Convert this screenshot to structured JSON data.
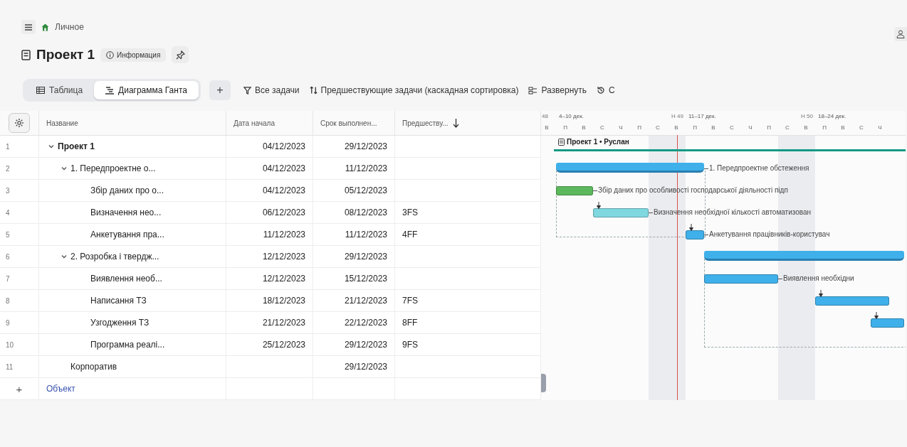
{
  "breadcrumb": {
    "label": "Личное"
  },
  "title": {
    "text": "Проект 1",
    "info_button": "Информация"
  },
  "view_tabs": [
    {
      "label": "Таблица",
      "selected": false
    },
    {
      "label": "Диаграмма Ганта",
      "selected": true
    }
  ],
  "add_view": "+",
  "toolbar": [
    {
      "kind": "filter",
      "label": "Все задачи"
    },
    {
      "kind": "sort",
      "label": "Предшествующие задачи (каскадная сортировка)"
    },
    {
      "kind": "expand",
      "label": "Развернуть"
    },
    {
      "kind": "history",
      "label": "С"
    }
  ],
  "table": {
    "columns": [
      "Название",
      "Дата начала",
      "Срок выполнен...",
      "Предшеству..."
    ],
    "rows": [
      {
        "number": "1",
        "name": "Проект 1",
        "start": "04/12/2023",
        "end": "29/12/2023",
        "expanded": true,
        "color": "#139a84",
        "gantt_label": "Проект 1 • Руслан",
        "children": [
          {
            "number": "2",
            "name": "1. Передпроектне о...",
            "start": "04/12/2023",
            "end": "11/12/2023",
            "expanded": true,
            "color": "#3fb0ea",
            "gantt_label": "1. Передпроектне обстеження",
            "children": [
              {
                "number": "3",
                "name": "Збір даних про о...",
                "start": "04/12/2023",
                "end": "05/12/2023",
                "color": "#5cb85c",
                "gantt_label": "Збір даних про особливості господарської діяльності підп"
              },
              {
                "number": "4",
                "name": "Визначення нео...",
                "start": "06/12/2023",
                "end": "08/12/2023",
                "predecessor": "3FS",
                "color": "#7fd8e0",
                "gantt_label": "Визначення необхідної кількості автоматизован"
              },
              {
                "number": "5",
                "name": "Анкетування пра...",
                "start": "11/12/2023",
                "end": "11/12/2023",
                "predecessor": "4FF",
                "color": "#3fb0ea",
                "gantt_label": "Анкетування працівників-користувач"
              }
            ]
          },
          {
            "number": "6",
            "name": "2. Розробка і твердж...",
            "start": "12/12/2023",
            "end": "29/12/2023",
            "expanded": true,
            "color": "#3fb0ea",
            "children": [
              {
                "number": "7",
                "name": "Виявлення необ...",
                "start": "12/12/2023",
                "end": "15/12/2023",
                "color": "#3fb0ea",
                "gantt_label": "Виявлення необхідни"
              },
              {
                "number": "8",
                "name": "Написання ТЗ",
                "start": "18/12/2023",
                "end": "21/12/2023",
                "predecessor": "7FS",
                "color": "#3fb0ea"
              },
              {
                "number": "9",
                "name": "Узгодження ТЗ",
                "start": "21/12/2023",
                "end": "22/12/2023",
                "predecessor": "8FF",
                "color": "#3fb0ea"
              },
              {
                "number": "10",
                "name": "Програмна реалі...",
                "start": "25/12/2023",
                "end": "29/12/2023",
                "predecessor": "9FS"
              }
            ]
          },
          {
            "number": "11",
            "name": "Корпоратив",
            "end": "29/12/2023"
          }
        ]
      }
    ],
    "add_row": {
      "icon": "+",
      "label": "Объект"
    }
  },
  "timeline": {
    "weeks": [
      {
        "number": "48"
      },
      {
        "label": "4–10 дек.",
        "number": "Н 49"
      },
      {
        "label": "11–17 дек.",
        "number": "Н 50"
      },
      {
        "label": "18–24 дек."
      }
    ],
    "days": [
      "В",
      "П",
      "В",
      "С",
      "Ч",
      "П",
      "С",
      "В",
      "П",
      "В",
      "С",
      "Ч",
      "П",
      "С",
      "В",
      "П",
      "В",
      "С",
      "Ч"
    ]
  }
}
